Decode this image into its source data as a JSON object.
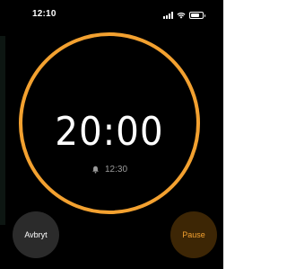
{
  "status_bar": {
    "time": "12:10",
    "icons": [
      "signal-icon",
      "wifi-icon",
      "battery-icon"
    ]
  },
  "timer": {
    "remaining": "20:00",
    "alarm_time": "12:30",
    "alarm_icon": "bell-icon",
    "progress": 1.0
  },
  "buttons": {
    "cancel_label": "Avbryt",
    "pause_label": "Pause"
  },
  "colors": {
    "background": "#000000",
    "accent": "#f3a130",
    "ring": "#f3a130",
    "text": "#ffffff",
    "muted": "#9a9a9a",
    "cancel_bg": "#2b2b2b",
    "pause_bg": "#3d2605"
  }
}
